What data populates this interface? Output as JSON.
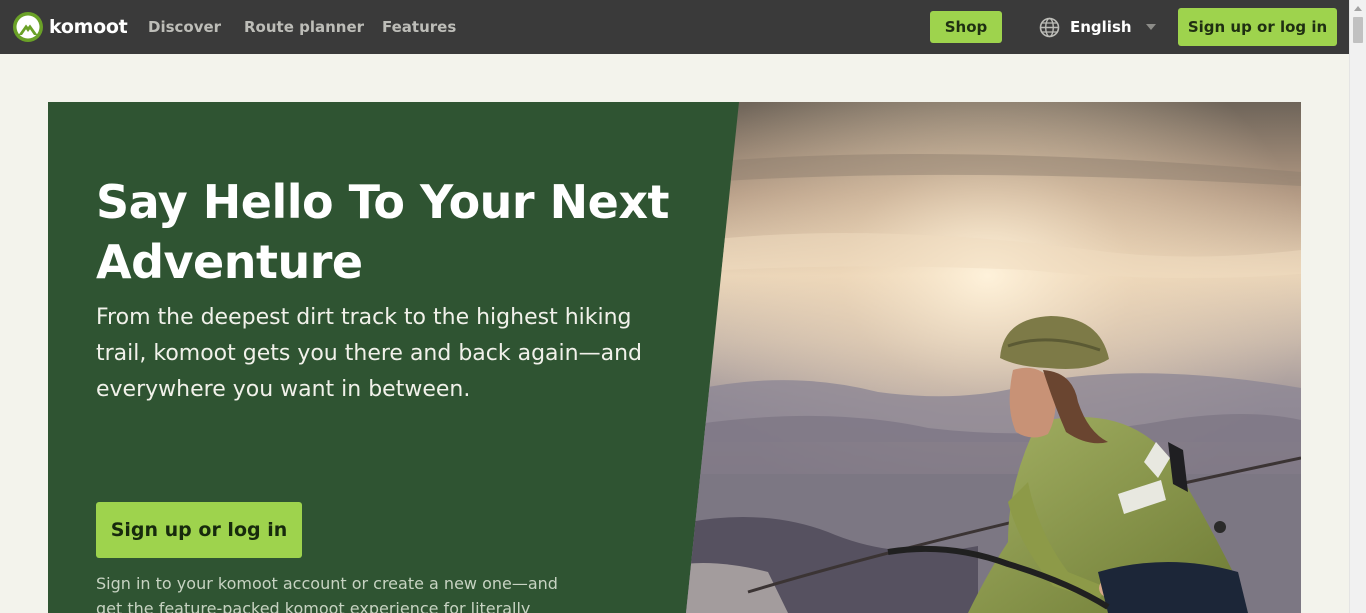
{
  "nav": {
    "logo_text": "komoot",
    "links": [
      {
        "label": "Discover"
      },
      {
        "label": "Route planner"
      },
      {
        "label": "Features"
      }
    ],
    "shop_label": "Shop",
    "language": "English",
    "signup_label": "Sign up or log in"
  },
  "hero": {
    "title": "Say Hello To Your Next Adventure",
    "description": "From the deepest dirt track to the highest hiking trail, komoot gets you there and back again—and everywhere you want in between.",
    "cta_label": "Sign up or log in",
    "subtext": "Sign in to your komoot account or create a new one—and get the feature-packed komoot experience for literally"
  },
  "colors": {
    "nav_background": "#3a3a3a",
    "accent_green": "#9ed34d",
    "hero_green": "#2f5432",
    "page_background": "#f3f3ec"
  },
  "icons": {
    "logo": "komoot-mountain-logo",
    "language": "globe-icon",
    "language_dropdown": "caret-down-icon"
  }
}
